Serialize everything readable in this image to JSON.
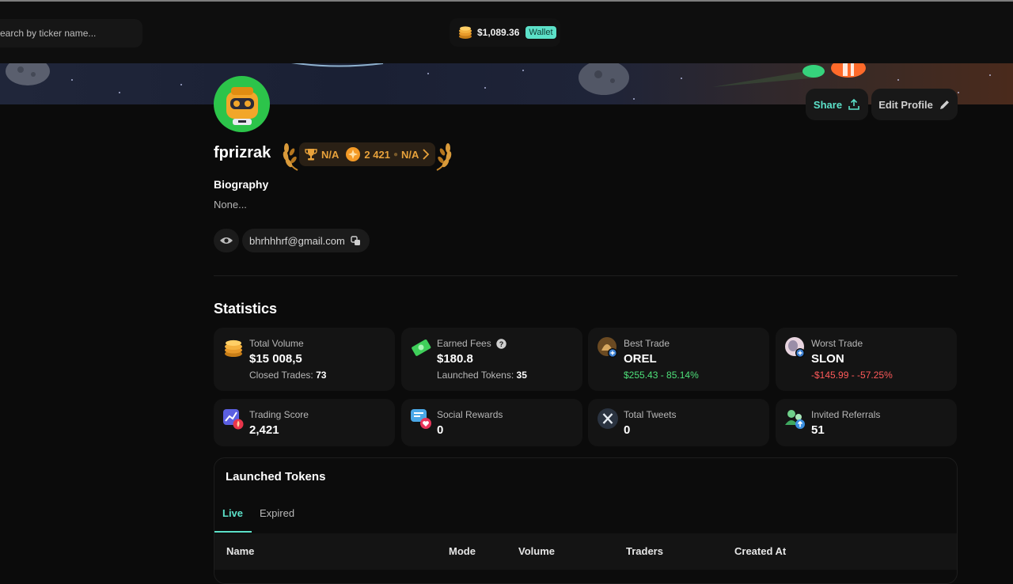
{
  "header": {
    "search_placeholder": "earch by ticker name...",
    "balance": "$1,089.36",
    "wallet_label": "Wallet"
  },
  "profile": {
    "share_label": "Share",
    "edit_label": "Edit Profile",
    "username": "fprizrak",
    "rank": {
      "trophy_value": "N/A",
      "points": "2 421",
      "tier": "N/A"
    },
    "bio_heading": "Biography",
    "bio_text": "None...",
    "email": "bhrhhhrf@gmail.com"
  },
  "statistics": {
    "title": "Statistics",
    "cards": [
      {
        "label": "Total Volume",
        "value": "$15 008,5",
        "sub_label": "Closed Trades:",
        "sub_value": "73",
        "icon": "coins-icon"
      },
      {
        "label": "Earned Fees",
        "value": "$180.8",
        "sub_label": "Launched Tokens:",
        "sub_value": "35",
        "icon": "money-icon"
      },
      {
        "label": "Best Trade",
        "value": "OREL",
        "sub": "$255.43 - 85.14%",
        "icon": "token-avatar-icon"
      },
      {
        "label": "Worst Trade",
        "value": "SLON",
        "sub": "-$145.99 - -57.25%",
        "icon": "token-avatar-icon"
      },
      {
        "label": "Trading Score",
        "value": "2,421",
        "icon": "chart-fire-icon"
      },
      {
        "label": "Social Rewards",
        "value": "0",
        "icon": "chat-heart-icon"
      },
      {
        "label": "Total Tweets",
        "value": "0",
        "icon": "x-logo-icon"
      },
      {
        "label": "Invited Referrals",
        "value": "51",
        "icon": "users-icon"
      }
    ]
  },
  "launched_tokens": {
    "title": "Launched Tokens",
    "tabs": [
      "Live",
      "Expired"
    ],
    "active_tab": "Live",
    "columns": [
      "Name",
      "Mode",
      "Volume",
      "Traders",
      "Created At"
    ]
  },
  "colors": {
    "accent": "#5ce1c9",
    "positive": "#4ee07a",
    "negative": "#ff5a5a",
    "gold": "#e8a23b"
  }
}
